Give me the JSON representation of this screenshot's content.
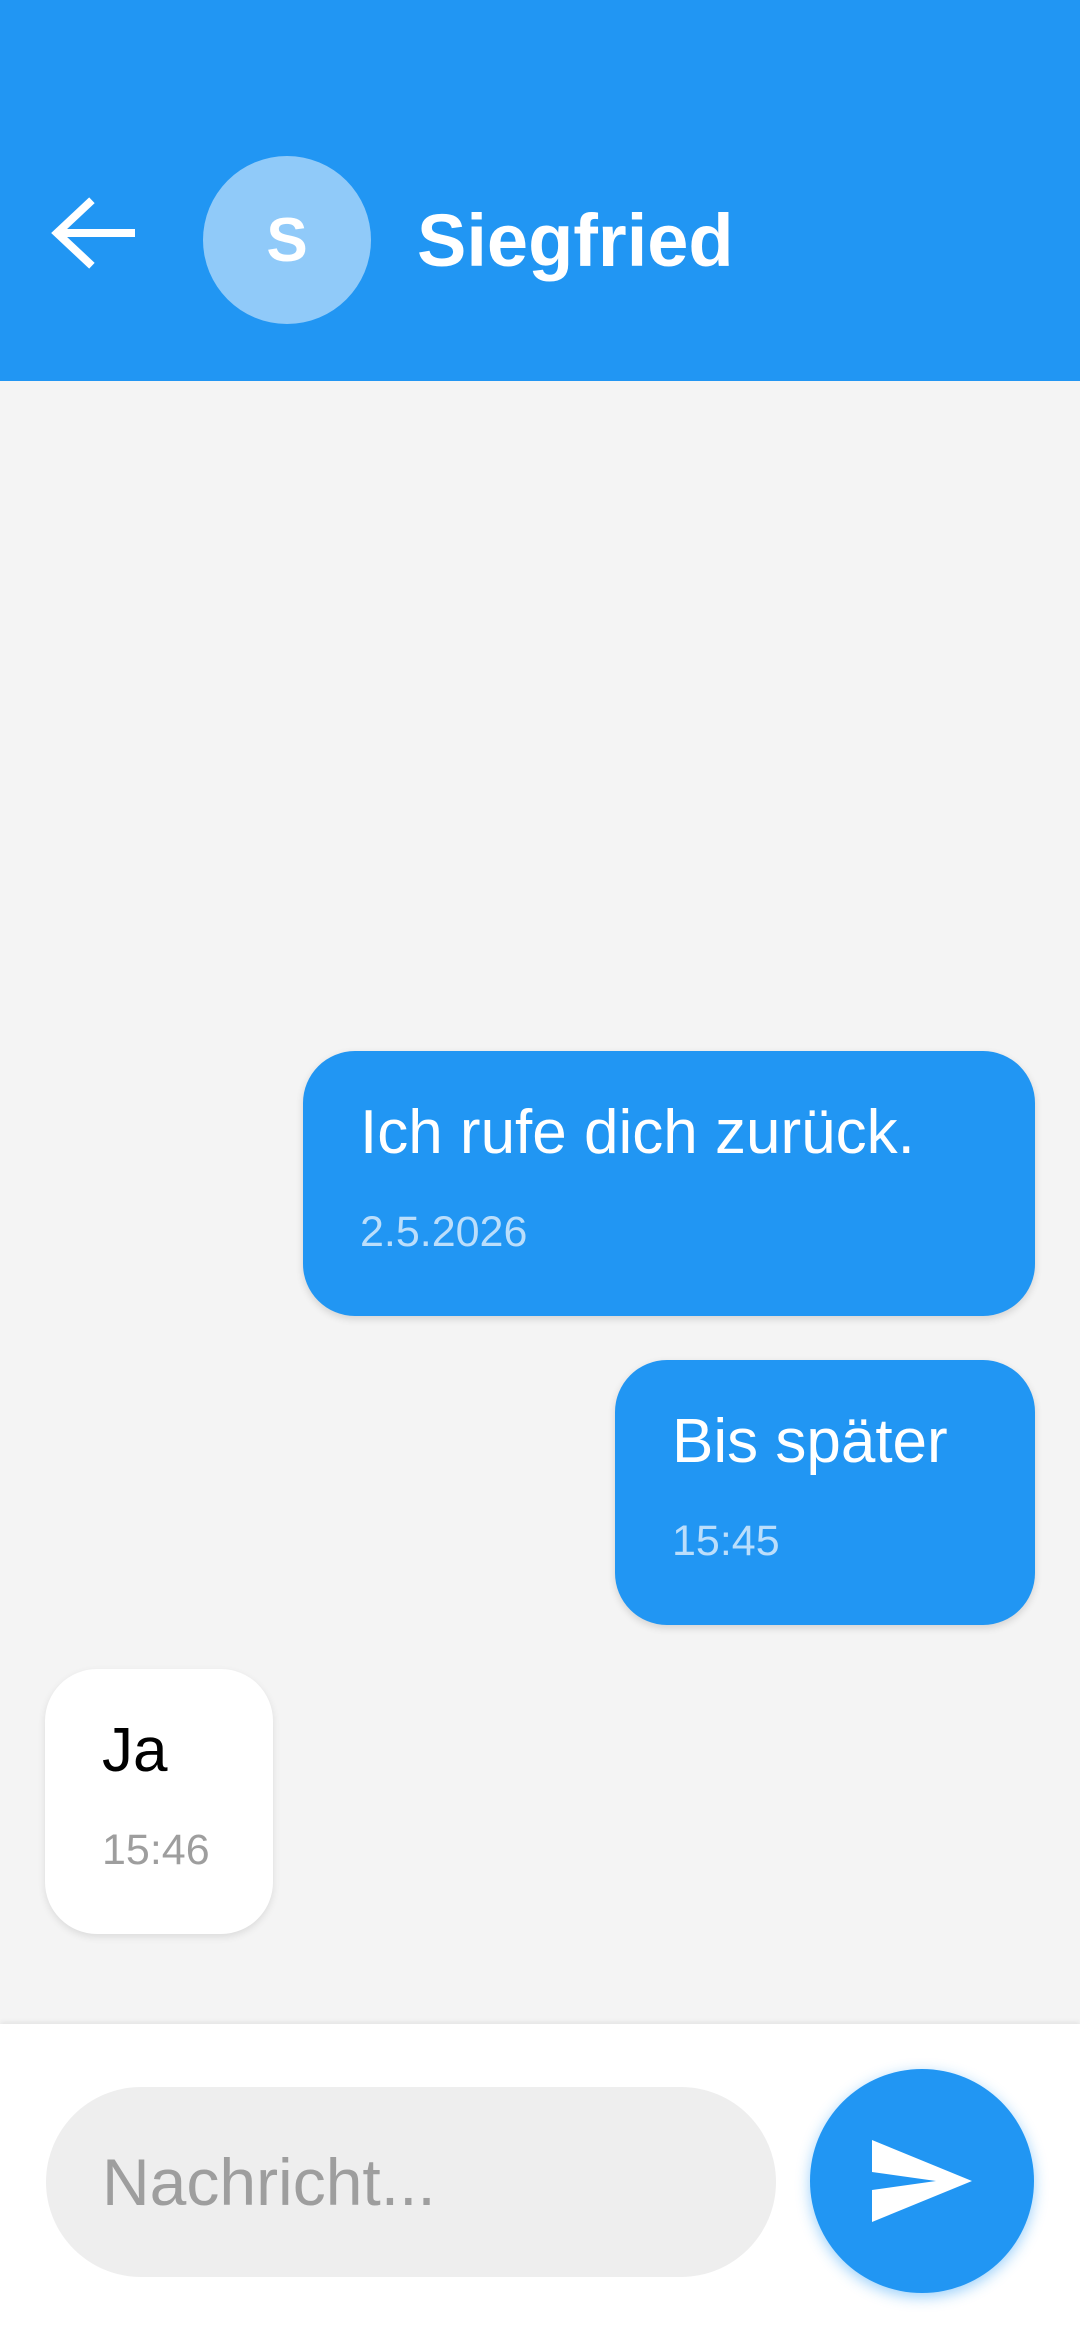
{
  "app": {
    "accent_color": "#2196f3",
    "avatar_color": "#90caf9"
  },
  "header": {
    "back_icon": "arrow-back-icon",
    "avatar_initial": "S",
    "contact_name": "Siegfried"
  },
  "messages": [
    {
      "direction": "outgoing",
      "text": "Ich rufe dich zurück.",
      "time": "2.5.2026"
    },
    {
      "direction": "outgoing",
      "text": "Bis später",
      "time": "15:45"
    },
    {
      "direction": "incoming",
      "text": "Ja",
      "time": "15:46"
    }
  ],
  "composer": {
    "value": "",
    "placeholder": "Nachricht...",
    "send_icon": "send-icon"
  }
}
